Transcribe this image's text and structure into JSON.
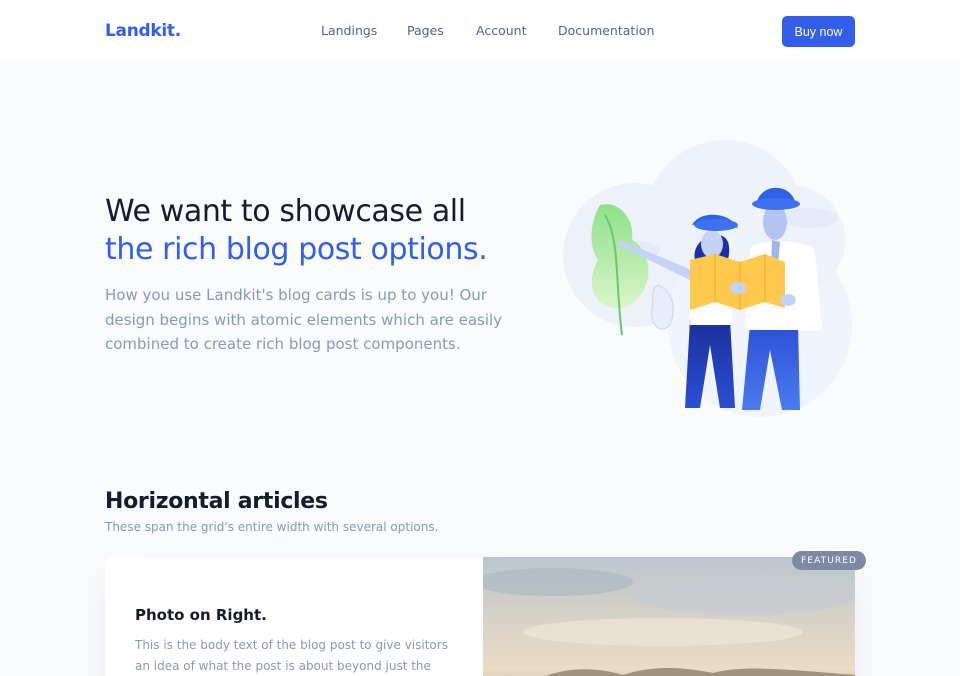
{
  "brand": {
    "name": "Landkit."
  },
  "nav": {
    "items": [
      "Landings",
      "Pages",
      "Account",
      "Documentation"
    ],
    "cta": "Buy now"
  },
  "hero": {
    "title_line1": "We want to showcase all",
    "title_line2": "the rich blog post options.",
    "lead": "How you use Landkit's blog cards is up to you! Our design begins with atomic elements which are easily combined to create rich blog post components."
  },
  "section": {
    "title": "Horizontal articles",
    "subtitle": "These span the grid's entire width with several options."
  },
  "card": {
    "badge": "FEATURED",
    "title": "Photo on Right.",
    "text": "This is the body text of the blog post to give visitors an idea of what the post is about beyond just the title. It"
  },
  "colors": {
    "primary": "#335eea",
    "heading": "#161c2d",
    "muted": "#869ab8",
    "nav": "#506690",
    "background": "#f9fbfd"
  },
  "icons": {
    "hero_illustration": "travelers-with-map-illustration"
  }
}
